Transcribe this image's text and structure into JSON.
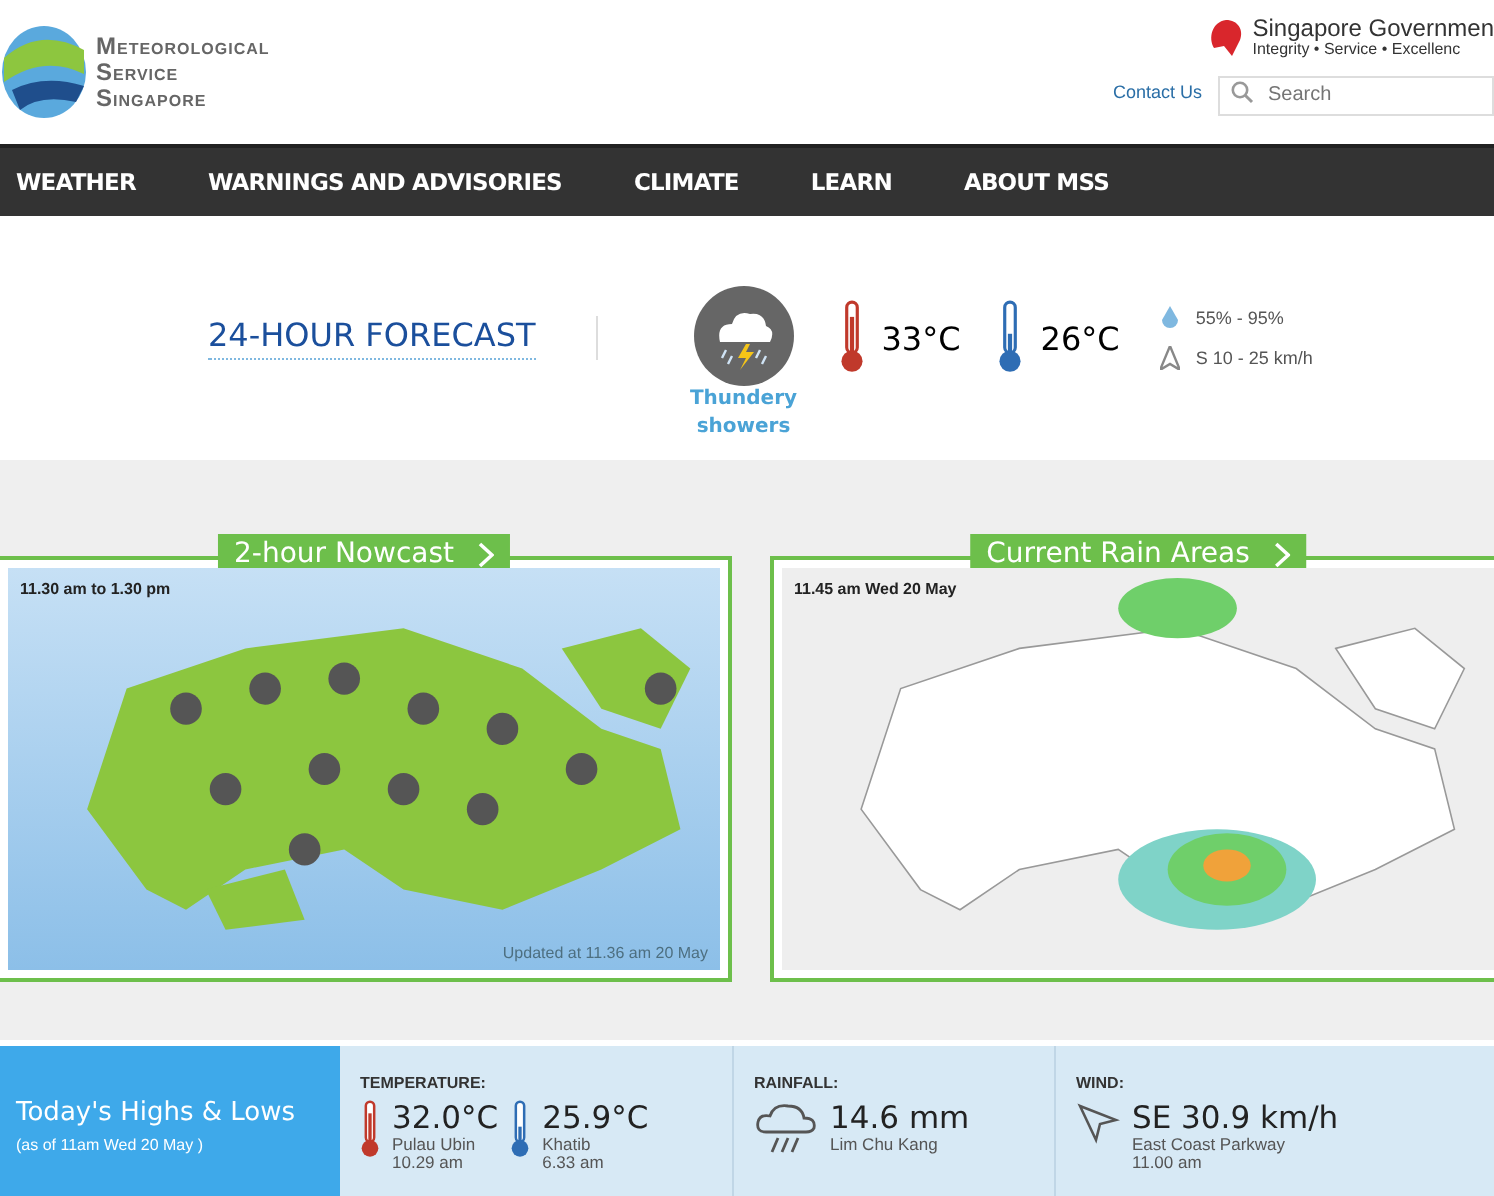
{
  "logo": {
    "lines": [
      "Meteorological",
      "Service",
      "Singapore"
    ]
  },
  "gov": {
    "name": "Singapore",
    "name_accent": "Governmen",
    "motto": "Integrity • Service • Excellenc"
  },
  "contact": "Contact Us",
  "search": {
    "placeholder": "Search"
  },
  "nav": [
    "WEATHER",
    "WARNINGS AND ADVISORIES",
    "CLIMATE",
    "LEARN",
    "ABOUT MSS"
  ],
  "forecast": {
    "title": "24-HOUR FORECAST",
    "condition": "Thundery showers",
    "high": "33°C",
    "low": "26°C",
    "humidity": "55% - 95%",
    "wind": "S 10 - 25 km/h"
  },
  "panels": [
    {
      "kind": "nowcast",
      "title": "2-hour Nowcast",
      "time": "11.30 am to 1.30 pm",
      "updated": "Updated at 11.36 am 20 May"
    },
    {
      "kind": "rain",
      "title": "Current Rain Areas",
      "time": "11.45 am Wed 20 May"
    }
  ],
  "highs_lows": {
    "title": "Today's Highs & Lows",
    "subtitle": "(as of 11am Wed 20 May )",
    "temperature": {
      "label": "TEMPERATURE:",
      "high": {
        "value": "32.0°C",
        "place": "Pulau Ubin",
        "time": "10.29 am"
      },
      "low": {
        "value": "25.9°C",
        "place": "Khatib",
        "time": "6.33 am"
      }
    },
    "rainfall": {
      "label": "RAINFALL:",
      "value": "14.6 mm",
      "place": "Lim Chu Kang"
    },
    "wind": {
      "label": "WIND:",
      "value": "SE 30.9 km/h",
      "place": "East Coast Parkway",
      "time": "11.00 am"
    }
  }
}
